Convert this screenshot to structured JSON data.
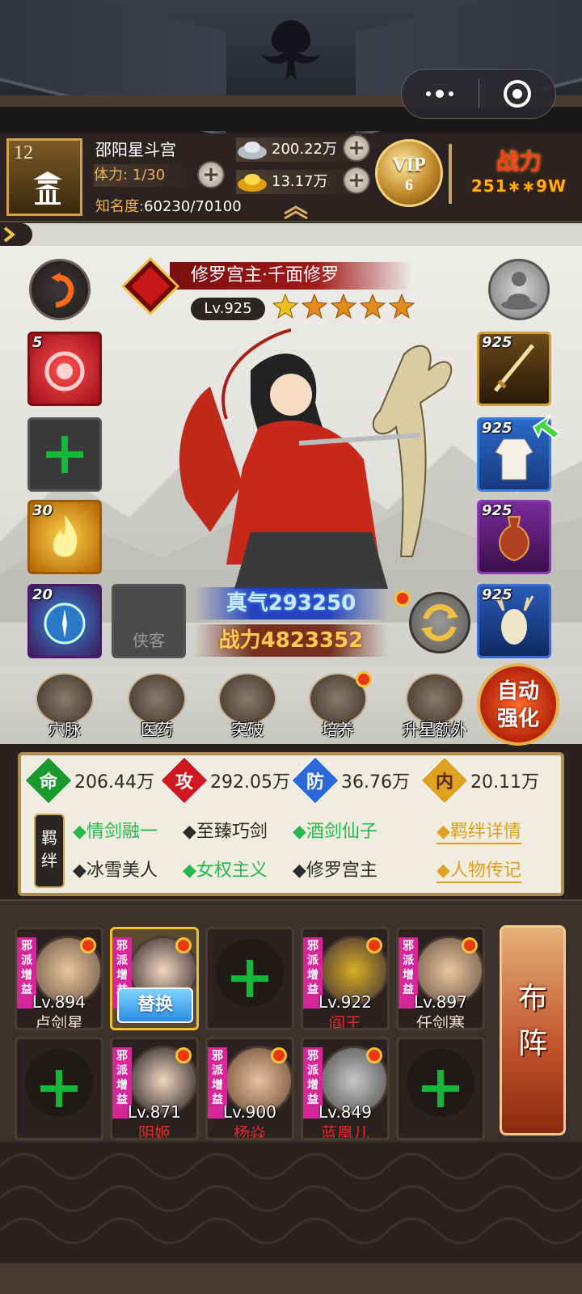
{
  "player": {
    "level": "12",
    "name": "邵阳星斗宫",
    "stamina": "体力: 1/30",
    "fame_label": "知名度:",
    "fame_value": "60230/70100",
    "silver": "200.22万",
    "gold": "13.17万",
    "vip_label": "VIP",
    "vip_level": "6",
    "power_label": "战力",
    "power_value": "251∗∗9W"
  },
  "hero": {
    "name": "修罗宫主·千面修罗",
    "level": "Lv.925",
    "stars": 5,
    "zhenqi": "真气293250",
    "power": "战力4823352"
  },
  "left_slots": [
    {
      "level": "5",
      "kind": "skill-red"
    },
    {
      "level": "",
      "kind": "empty"
    },
    {
      "level": "30",
      "kind": "skill-gold"
    },
    {
      "level": "20",
      "kind": "treasure"
    },
    {
      "label": "侠客",
      "kind": "companion"
    }
  ],
  "equipment": [
    {
      "level": "925",
      "item": "sword"
    },
    {
      "level": "925",
      "item": "robe"
    },
    {
      "level": "925",
      "item": "vase"
    },
    {
      "level": "925",
      "item": "deer"
    }
  ],
  "actions": [
    {
      "label": "穴脉"
    },
    {
      "label": "医药"
    },
    {
      "label": "突破"
    },
    {
      "label": "培养"
    },
    {
      "label": "升星额外"
    }
  ],
  "auto_strengthen": "自动强化",
  "stats": [
    {
      "icon": "命",
      "value": "206.44万",
      "color": "#1a9a2a"
    },
    {
      "icon": "攻",
      "value": "292.05万",
      "color": "#d01820"
    },
    {
      "icon": "防",
      "value": "36.76万",
      "color": "#2a6ad8"
    },
    {
      "icon": "内",
      "value": "20.11万",
      "color": "#e0a020"
    }
  ],
  "bond_label": "羁绊",
  "bonds": [
    {
      "text": "◆情剑融一",
      "active": true
    },
    {
      "text": "◆至臻巧剑",
      "active": false
    },
    {
      "text": "◆酒剑仙子",
      "active": true
    },
    {
      "text": "◆冰雪美人",
      "active": false
    },
    {
      "text": "◆女权主义",
      "active": true
    },
    {
      "text": "◆修罗宫主",
      "active": false
    }
  ],
  "links": {
    "bond_detail": "◆羁绊详情",
    "biography": "◆人物传记"
  },
  "team": [
    {
      "tag": "邪派增益",
      "level": "Lv.894",
      "name": "卢剑星",
      "red": false
    },
    {
      "tag": "邪派增益",
      "replace": "替换",
      "selected": true
    },
    {
      "empty": true
    },
    {
      "tag": "邪派增益",
      "level": "Lv.922",
      "name": "阎王",
      "red": true
    },
    {
      "tag": "邪派增益",
      "level": "Lv.897",
      "name": "任剑寒",
      "red": false
    },
    {
      "empty": true
    },
    {
      "tag": "邪派增益",
      "level": "Lv.871",
      "name": "阴姬",
      "red": true
    },
    {
      "tag": "邪派增益",
      "level": "Lv.900",
      "name": "杨焱",
      "red": true
    },
    {
      "tag": "邪派增益",
      "level": "Lv.849",
      "name": "蓝凰儿",
      "red": true
    },
    {
      "empty": true
    }
  ],
  "formation": "布阵",
  "colors": {
    "accent_gold": "#d4a044",
    "bond_green": "#23b84a",
    "link_gold": "#e0a020",
    "enemy_red": "#e82828"
  }
}
